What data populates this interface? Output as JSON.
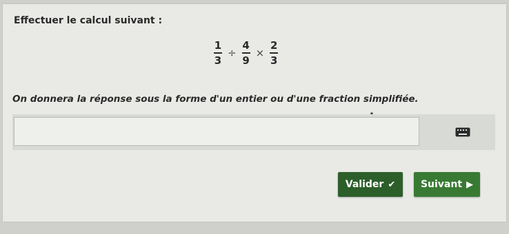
{
  "exercise": {
    "prompt": "Effectuer le calcul suivant :",
    "expression": [
      {
        "num": "1",
        "den": "3"
      },
      {
        "op": "÷"
      },
      {
        "num": "4",
        "den": "9"
      },
      {
        "op": "×"
      },
      {
        "num": "2",
        "den": "3"
      }
    ],
    "instruction": "On donnera la réponse sous la forme d'un entier ou d'une fraction simplifiée."
  },
  "answer": {
    "value": "",
    "placeholder": ""
  },
  "icons": {
    "keyboard": "keyboard-icon",
    "cursor": "text-cursor-icon",
    "check": "check-icon",
    "next": "play-arrow-icon"
  },
  "buttons": {
    "validate_label": "Valider",
    "next_label": "Suivant"
  },
  "colors": {
    "validate": "#2c5e2a",
    "next": "#387a33"
  }
}
